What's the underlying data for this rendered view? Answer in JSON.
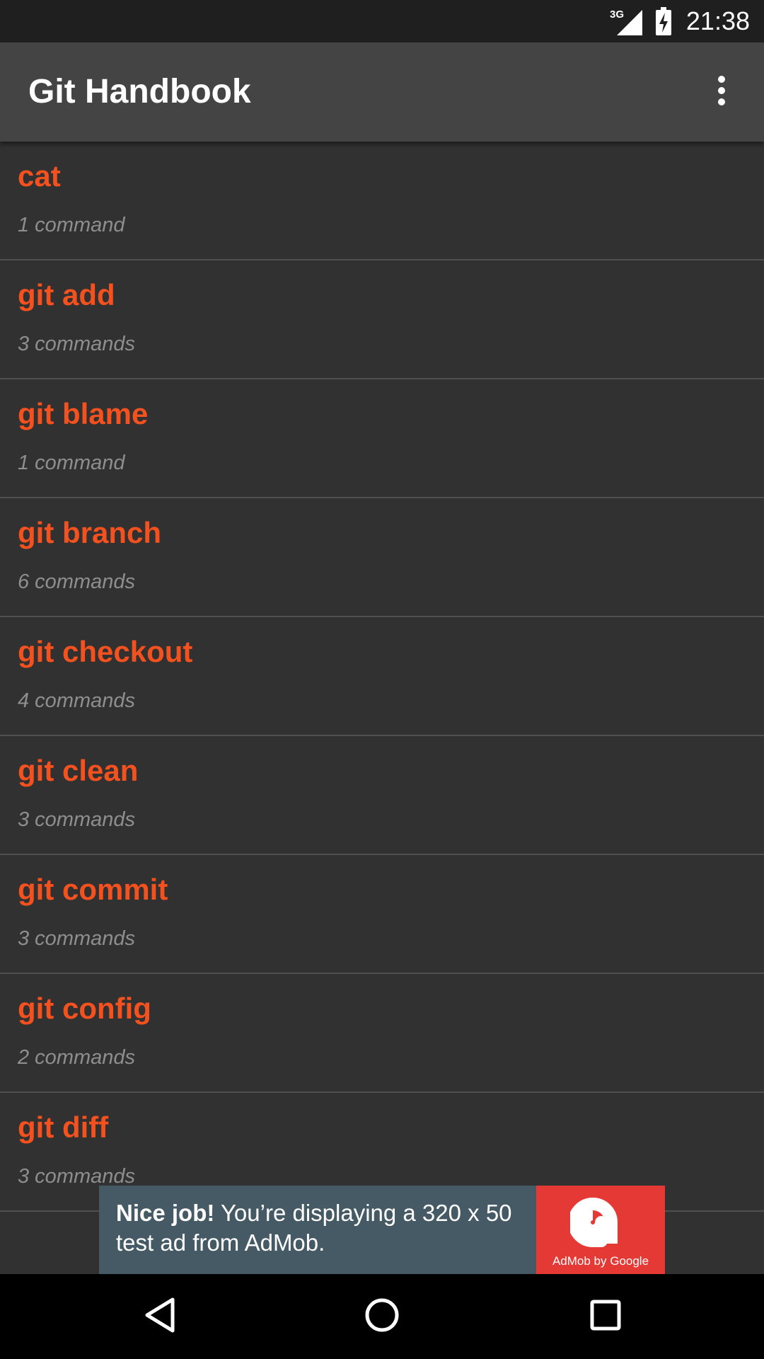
{
  "status_bar": {
    "network_label": "3G",
    "time": "21:38",
    "icons": [
      "signal-icon",
      "battery-icon"
    ]
  },
  "app_bar": {
    "title": "Git Handbook",
    "menu_icon": "more-vert-icon"
  },
  "commands": [
    {
      "name": "cat",
      "count": "1 command"
    },
    {
      "name": "git add",
      "count": "3 commands"
    },
    {
      "name": "git blame",
      "count": "1 command"
    },
    {
      "name": "git branch",
      "count": "6 commands"
    },
    {
      "name": "git checkout",
      "count": "4 commands"
    },
    {
      "name": "git clean",
      "count": "3 commands"
    },
    {
      "name": "git commit",
      "count": "3 commands"
    },
    {
      "name": "git config",
      "count": "2 commands"
    },
    {
      "name": "git diff",
      "count": "3 commands"
    }
  ],
  "ad": {
    "headline": "Nice job!",
    "body": "You’re displaying a 320 x 50 test ad from AdMob.",
    "brand": "AdMob by Google",
    "logo_icon": "admob-logo-icon"
  },
  "nav_bar": {
    "icons": [
      "back-icon",
      "home-icon",
      "recents-icon"
    ]
  },
  "colors": {
    "accent": "#f4511e",
    "background": "#313131",
    "app_bar": "#444444",
    "status_bar": "#1f1f1f",
    "secondary_text": "#8e8e8e",
    "ad_background": "#455a64",
    "ad_logo_background": "#e53935"
  }
}
